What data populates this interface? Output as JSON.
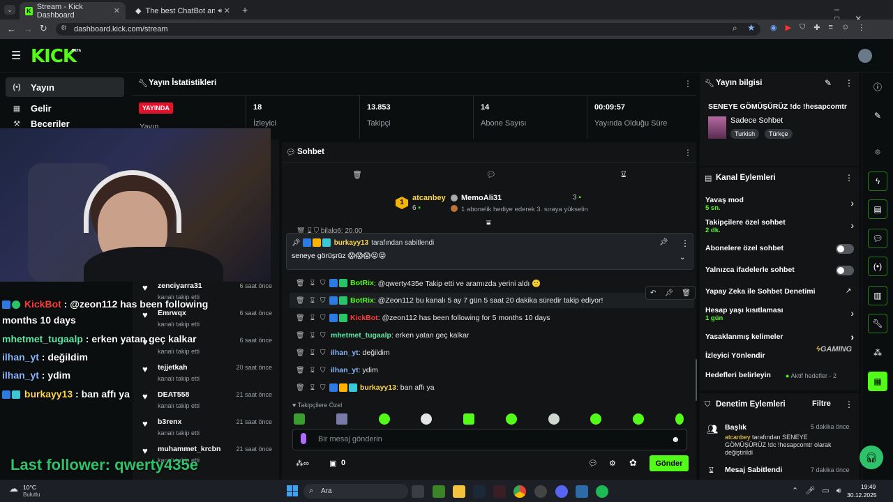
{
  "browser": {
    "tabs": [
      {
        "label": "Stream - Kick Dashboard"
      },
      {
        "label": "The best ChatBot and Widg"
      }
    ],
    "url": "dashboard.kick.com/stream"
  },
  "header": {
    "logo": "KICK",
    "beta": "BETA"
  },
  "sidebar": {
    "items": [
      {
        "label": "Yayın",
        "icon": "broadcast-icon"
      },
      {
        "label": "Gelir",
        "icon": "chart-icon"
      },
      {
        "label": "Beceriler",
        "icon": "tools-icon"
      }
    ]
  },
  "stats": {
    "title": "Yayın İstatistikleri",
    "live_badge": "YAYINDA",
    "live_label": "Yayın",
    "items": [
      {
        "value": "18",
        "label": "İzleyici"
      },
      {
        "value": "13.853",
        "label": "Takipçi"
      },
      {
        "value": "14",
        "label": "Abone Sayısı"
      },
      {
        "value": "00:09:57",
        "label": "Yayında Olduğu Süre"
      }
    ]
  },
  "chat": {
    "title": "Sohbet",
    "gift_user": "atcanbey",
    "gift_count": "6",
    "gift_rank": "1",
    "gifter2": "MemoAli31",
    "gifter2_count": "3",
    "gifter2_text": "1 abonelik hediye ederek 3. sıraya yükselin",
    "partial_line": "bilalg6: 20.00",
    "pinned_by": "burkayy13",
    "pinned_suffix": "tarafından sabitlendi",
    "pinned_msg": "seneye görüşrüz 😱😱😱😝😝",
    "messages": [
      {
        "user": "BotRix",
        "color": "#53fc18",
        "text": ": @qwerty435e Takip etti ve aramızda yerini aldı 🙂"
      },
      {
        "user": "BotRix",
        "color": "#53fc18",
        "text": ": @Zeon112 bu kanalı 5 ay 7 gün 5 saat 20 dakika süredir takip ediyor!"
      },
      {
        "user": "KickBot",
        "color": "#ff3b3b",
        "text": ": @zeon112 has been following for 5 months 10 days"
      },
      {
        "user": "mhetmet_tugaalp",
        "color": "#5ee8a8",
        "text": ": erken yatan geç kalkar"
      },
      {
        "user": "ilhan_yt",
        "color": "#8ab4f8",
        "text": ": değildim"
      },
      {
        "user": "ilhan_yt",
        "color": "#8ab4f8",
        "text": ": ydim"
      },
      {
        "user": "burkayy13",
        "color": "#ffd54a",
        "text": ": ban affı ya"
      }
    ],
    "followers_only": "Takipçilere Özel",
    "input_placeholder": "Bir mesaj gönderin",
    "points": "0",
    "send_label": "Gönder"
  },
  "followers": [
    {
      "name": "zenciyarra31",
      "text": "kanalı takip etti",
      "when": "6 saat önce"
    },
    {
      "name": "Emrwqx",
      "text": "kanalı takip etti",
      "when": "6 saat önce"
    },
    {
      "name": "",
      "text": "kanalı takip etti",
      "when": "6 saat önce"
    },
    {
      "name": "tejjetkah",
      "text": "kanalı takip etti",
      "when": "20 saat önce"
    },
    {
      "name": "DEAT558",
      "text": "kanalı takip etti",
      "when": "21 saat önce"
    },
    {
      "name": "b3renx",
      "text": "kanalı takip etti",
      "when": "21 saat önce"
    },
    {
      "name": "muhammet_krcbn",
      "text": "kanalı takip etti",
      "when": "21 saat önce"
    }
  ],
  "overlay": {
    "lines": [
      {
        "user": "KickBot",
        "text": " : @zeon112 has been following"
      },
      {
        "user": "",
        "text": "months 10 days"
      },
      {
        "user": "mhetmet_tugaalp",
        "text": " : erken yatan geç kalkar"
      },
      {
        "user": "ilhan_yt",
        "text": " : değildim"
      },
      {
        "user": "ilhan_yt",
        "text": " : ydim"
      },
      {
        "user": "burkayy13",
        "text": " : ban affı ya"
      }
    ],
    "last_follower": "Last follower: qwerty435e"
  },
  "stream_info": {
    "title": "Yayın bilgisi",
    "stream_title": "SENEYE GÖMÜŞÜRÜZ !dc !hesapcomtr",
    "category": "Sadece Sohbet",
    "tags": [
      "Turkish",
      "Türkçe"
    ]
  },
  "channel_actions": {
    "title": "Kanal Eylemleri",
    "slow_mode": "Yavaş mod",
    "slow_mode_val": "5 sn.",
    "followers_chat": "Takipçilere özel sohbet",
    "followers_chat_val": "2 dk.",
    "subs_chat": "Abonelere özel sohbet",
    "emotes_chat": "Yalnızca ifadelerle sohbet",
    "ai_mod": "Yapay Zeka ile Sohbet Denetimi",
    "age": "Hesap yaşı kısıtlaması",
    "age_val": "1 gün",
    "banned_words": "Yasaklanmış kelimeler",
    "viewer_redirect": "İzleyici Yönlendir",
    "goals": "Hedefleri belirleyin",
    "goals_val": "Aktif hedefler - 2",
    "watermark": "GAMING"
  },
  "mod_actions": {
    "title": "Denetim Eylemleri",
    "filter": "Filtre",
    "item1_title": "Başlık",
    "item1_when": "5 dakika önce",
    "item1_user": "atcanbey",
    "item1_text": " tarafından SENEYE GÖMÜŞÜRÜZ !dc !hesapcomtr olarak değiştirildi",
    "item2_title": "Mesaj Sabitlendi",
    "item2_when": "7 dakika önce"
  },
  "taskbar": {
    "weather_temp": "10°C",
    "weather_desc": "Bulutlu",
    "search": "Ara",
    "time": "19:49",
    "date": "30.12.2025"
  }
}
